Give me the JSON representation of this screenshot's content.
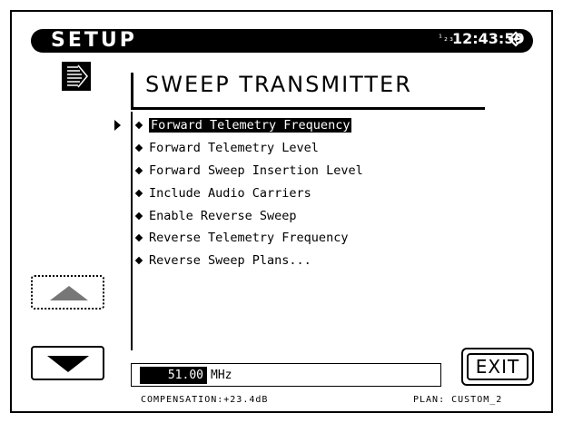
{
  "title_bar": {
    "title": "SETUP",
    "badge": "¹₂₃",
    "clock": "12:43:59"
  },
  "header": {
    "title": "SWEEP TRANSMITTER"
  },
  "menu": {
    "selected_index": 0,
    "items": [
      {
        "label": "Forward Telemetry Frequency"
      },
      {
        "label": "Forward Telemetry Level"
      },
      {
        "label": "Forward Sweep Insertion Level"
      },
      {
        "label": "Include Audio Carriers"
      },
      {
        "label": "Enable Reverse Sweep"
      },
      {
        "label": "Reverse Telemetry Frequency"
      },
      {
        "label": "Reverse Sweep Plans..."
      }
    ]
  },
  "value_field": {
    "value": "51.00",
    "unit": "MHz"
  },
  "buttons": {
    "up_icon": "triangle-up-icon",
    "down_icon": "triangle-down-icon",
    "exit_label": "EXIT"
  },
  "status": {
    "compensation": "COMPENSATION:+23.4dB",
    "plan": "PLAN: CUSTOM_2"
  },
  "colors": {
    "background": "#ffffff",
    "foreground": "#000000",
    "disabled_arrow": "#777777"
  }
}
